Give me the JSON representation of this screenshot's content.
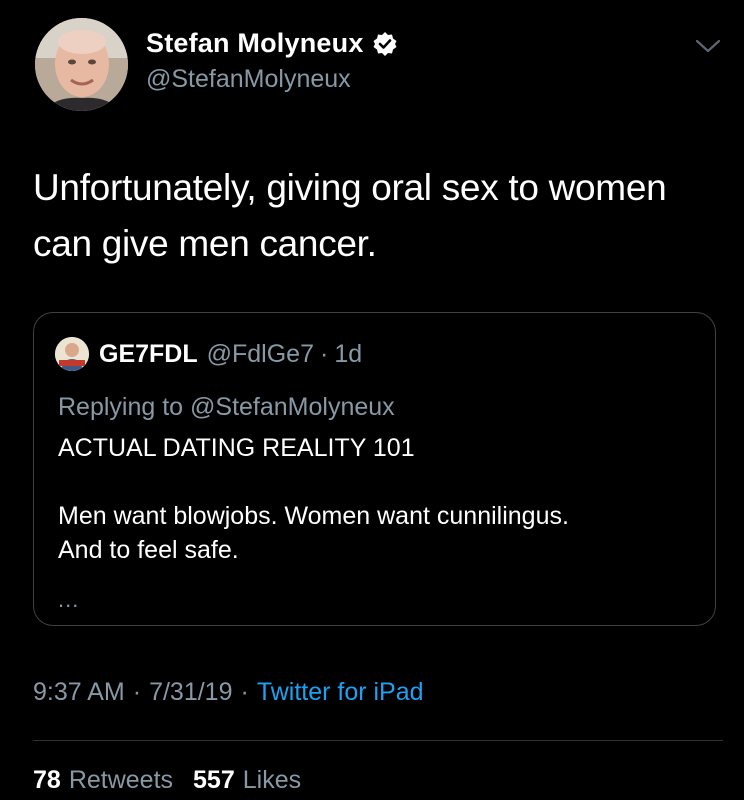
{
  "author": {
    "display_name": "Stefan Molyneux",
    "handle": "@StefanMolyneux",
    "verified": true,
    "avatar_icon": "profile-photo"
  },
  "tweet": {
    "text": "Unfortunately, giving oral sex to women can give men cancer."
  },
  "quoted_tweet": {
    "display_name": "GE7FDL",
    "handle": "@FdlGe7",
    "separator": "·",
    "time": "1d",
    "replying_to": "Replying to @StefanMolyneux",
    "body_line1": "ACTUAL DATING REALITY 101",
    "body_line2": "Men want blowjobs. Women want cunnilingus.",
    "body_line3": "And to feel safe.",
    "more": "..."
  },
  "meta": {
    "time": "9:37 AM",
    "separator": "·",
    "date": "7/31/19",
    "source": "Twitter for iPad"
  },
  "stats": {
    "retweets_count": "78",
    "retweets_label": "Retweets",
    "likes_count": "557",
    "likes_label": "Likes"
  },
  "colors": {
    "background": "#000000",
    "secondary_text": "#8899a6",
    "link": "#1da1f2",
    "border": "#3d4248"
  }
}
